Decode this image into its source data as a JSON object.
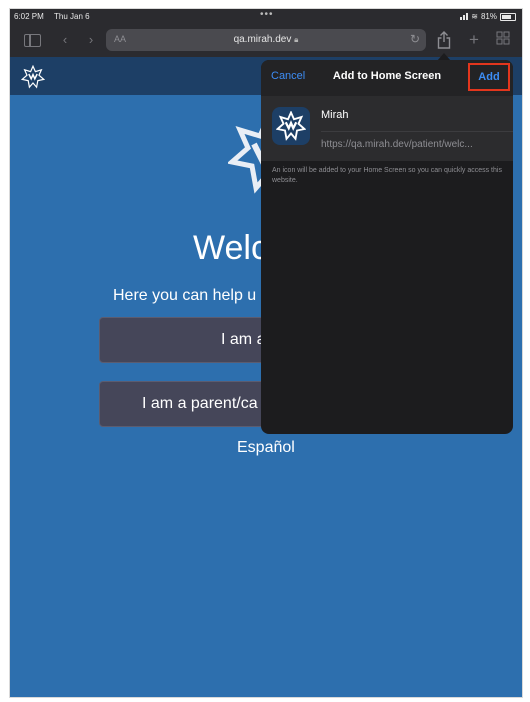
{
  "status_bar": {
    "time": "6:02 PM",
    "date": "Thu Jan 6",
    "battery": "81%"
  },
  "browser": {
    "text_size_label": "AA",
    "url": "qa.mirah.dev",
    "icons": [
      "sidebar-icon",
      "back-icon",
      "forward-icon",
      "reload-icon",
      "share-icon",
      "new-tab-icon",
      "tabs-icon",
      "lock-icon"
    ]
  },
  "page": {
    "welcome": "Welc",
    "subtitle": "Here you can help u",
    "btn_primary": "I am a",
    "btn_parent": "I am a parent/ca",
    "language_link": "Español"
  },
  "popover": {
    "cancel_label": "Cancel",
    "title": "Add to Home Screen",
    "add_label": "Add",
    "app_name": "Mirah",
    "app_url": "https://qa.mirah.dev/patient/welc...",
    "note": "An icon will be added to your Home Screen so you can quickly access this website."
  },
  "colors": {
    "page_background": "#2d6fae",
    "header_background": "#1d3f66",
    "popover_background": "#1c1c1e",
    "link_blue": "#3d8df5",
    "highlight_red": "#e3361d"
  }
}
